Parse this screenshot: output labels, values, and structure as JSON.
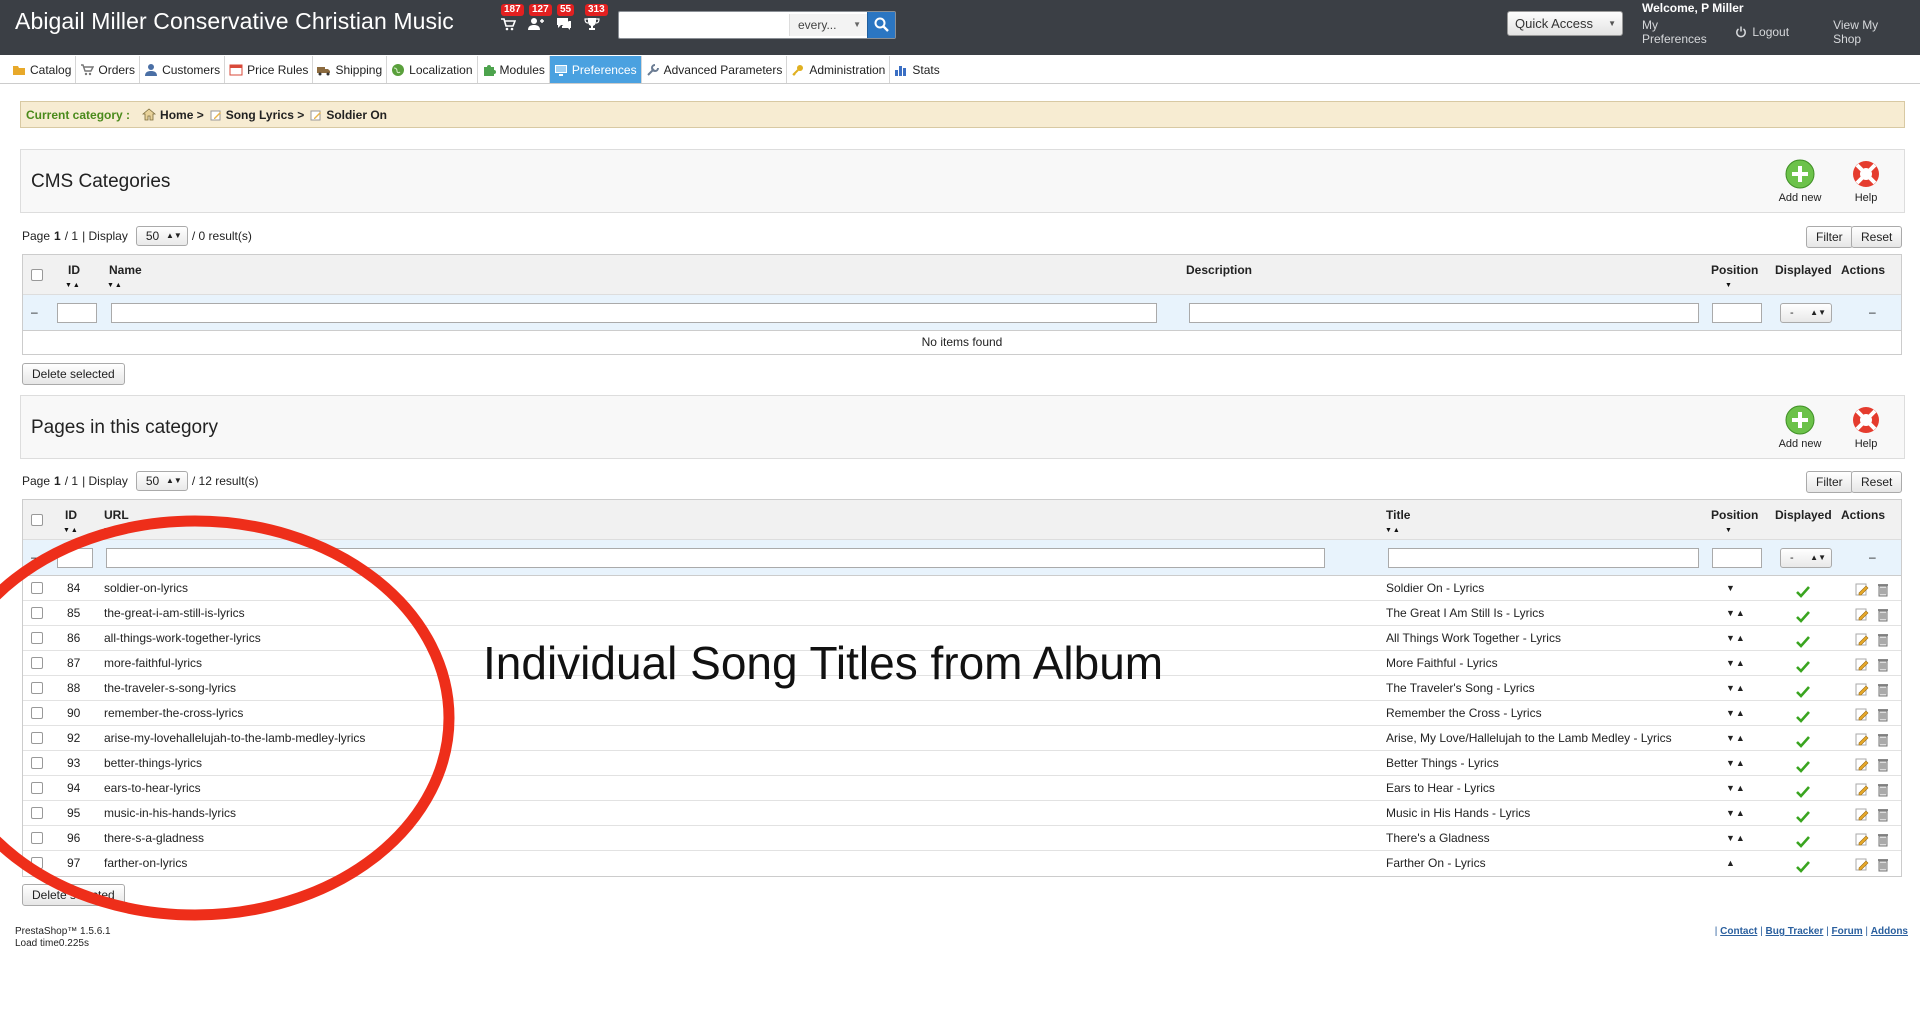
{
  "header": {
    "shop_name": "Abigail Miller Conservative Christian Music",
    "notifications": [
      {
        "count": "187",
        "icon": "cart-icon"
      },
      {
        "count": "127",
        "icon": "customers-icon"
      },
      {
        "count": "55",
        "icon": "messages-icon"
      },
      {
        "count": "313",
        "icon": "trophy-icon"
      }
    ],
    "search": {
      "value": "",
      "scope": "every..."
    },
    "quick_access": "Quick Access",
    "welcome": "Welcome, P Miller",
    "links": {
      "preferences": "My Preferences",
      "logout": "Logout",
      "view_shop": "View My Shop"
    }
  },
  "tabs": [
    {
      "label": "Catalog",
      "icon": "folder-icon",
      "color": "#e8a92a"
    },
    {
      "label": "Orders",
      "icon": "cart-icon",
      "color": "#777777"
    },
    {
      "label": "Customers",
      "icon": "user-icon",
      "color": "#4a6fa5"
    },
    {
      "label": "Price Rules",
      "icon": "price-tag-icon",
      "color": "#d94a3a"
    },
    {
      "label": "Shipping",
      "icon": "truck-icon",
      "color": "#8c6b3f"
    },
    {
      "label": "Localization",
      "icon": "globe-icon",
      "color": "#5aa03c"
    },
    {
      "label": "Modules",
      "icon": "puzzle-icon",
      "color": "#4da34d"
    },
    {
      "label": "Preferences",
      "icon": "monitor-icon",
      "color": "#ffffff",
      "active": true
    },
    {
      "label": "Advanced Parameters",
      "icon": "wrench-icon",
      "color": "#6b7c93"
    },
    {
      "label": "Administration",
      "icon": "key-icon",
      "color": "#e0b020"
    },
    {
      "label": "Stats",
      "icon": "bar-chart-icon",
      "color": "#3b6fc4"
    }
  ],
  "breadcrumb": {
    "label": "Current category :",
    "items": [
      "Home >",
      "Song Lyrics >",
      "Soldier On"
    ]
  },
  "cms_categories": {
    "title": "CMS Categories",
    "add_new": "Add new",
    "help": "Help",
    "pager": {
      "page_label": "Page",
      "page": "1",
      "pages": "/ 1",
      "display": "| Display",
      "per_page": "50",
      "results": "/ 0 result(s)"
    },
    "filter": "Filter",
    "reset": "Reset",
    "columns": {
      "id": "ID",
      "name": "Name",
      "description": "Description",
      "position": "Position",
      "displayed": "Displayed",
      "actions": "Actions"
    },
    "filter_displayed": "-",
    "empty": "No items found",
    "delete_selected": "Delete selected"
  },
  "pages": {
    "title": "Pages in this category",
    "add_new": "Add new",
    "help": "Help",
    "pager": {
      "page_label": "Page",
      "page": "1",
      "pages": "/ 1",
      "display": "| Display",
      "per_page": "50",
      "results": "/ 12 result(s)"
    },
    "filter": "Filter",
    "reset": "Reset",
    "columns": {
      "id": "ID",
      "url": "URL",
      "title": "Title",
      "position": "Position",
      "displayed": "Displayed",
      "actions": "Actions"
    },
    "filter_displayed": "-",
    "rows": [
      {
        "id": "84",
        "url": "soldier-on-lyrics",
        "title": "Soldier On - Lyrics",
        "arrows": "▼"
      },
      {
        "id": "85",
        "url": "the-great-i-am-still-is-lyrics",
        "title": "The Great I Am Still Is - Lyrics",
        "arrows": "▼▲"
      },
      {
        "id": "86",
        "url": "all-things-work-together-lyrics",
        "title": "All Things Work Together - Lyrics",
        "arrows": "▼▲"
      },
      {
        "id": "87",
        "url": "more-faithful-lyrics",
        "title": "More Faithful - Lyrics",
        "arrows": "▼▲"
      },
      {
        "id": "88",
        "url": "the-traveler-s-song-lyrics",
        "title": "The Traveler's Song - Lyrics",
        "arrows": "▼▲"
      },
      {
        "id": "90",
        "url": "remember-the-cross-lyrics",
        "title": "Remember the Cross - Lyrics",
        "arrows": "▼▲"
      },
      {
        "id": "92",
        "url": "arise-my-lovehallelujah-to-the-lamb-medley-lyrics",
        "title": "Arise, My Love/Hallelujah to the Lamb Medley - Lyrics",
        "arrows": "▼▲"
      },
      {
        "id": "93",
        "url": "better-things-lyrics",
        "title": "Better Things - Lyrics",
        "arrows": "▼▲"
      },
      {
        "id": "94",
        "url": "ears-to-hear-lyrics",
        "title": "Ears to Hear - Lyrics",
        "arrows": "▼▲"
      },
      {
        "id": "95",
        "url": "music-in-his-hands-lyrics",
        "title": "Music in His Hands - Lyrics",
        "arrows": "▼▲"
      },
      {
        "id": "96",
        "url": "there-s-a-gladness",
        "title": "There's a Gladness",
        "arrows": "▼▲"
      },
      {
        "id": "97",
        "url": "farther-on-lyrics",
        "title": "Farther On - Lyrics",
        "arrows": "▲"
      }
    ],
    "delete_selected": "Delete selected"
  },
  "footer": {
    "version": "PrestaShop™ 1.5.6.1",
    "load_time": "Load time0.225s",
    "links": [
      "Contact",
      "Bug Tracker",
      "Forum",
      "Addons"
    ]
  },
  "annotation": {
    "text": "Individual Song Titles from Album",
    "color": "#ee2e1a"
  }
}
